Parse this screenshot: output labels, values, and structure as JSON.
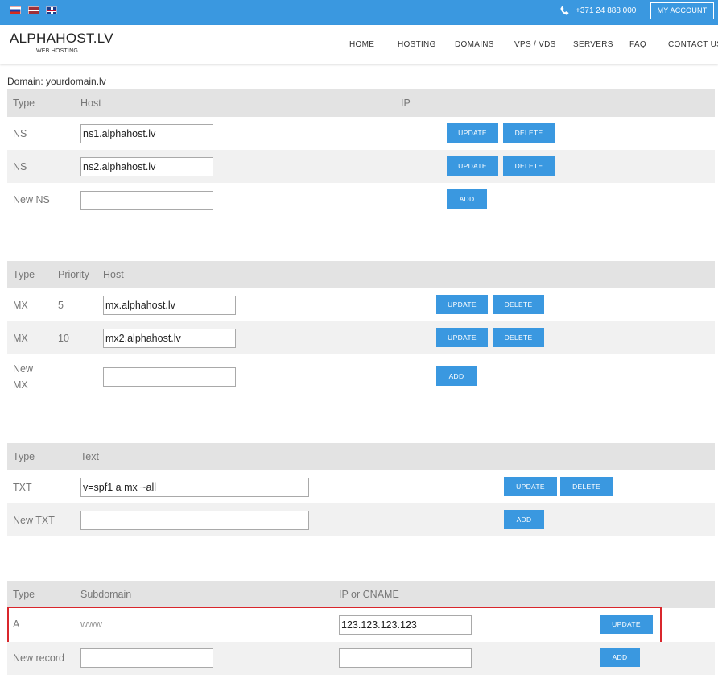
{
  "topbar": {
    "phone": "+371 24 888 000",
    "account_label": "MY ACCOUNT",
    "flags": [
      "flag-ru",
      "flag-lv",
      "flag-gb"
    ]
  },
  "header": {
    "logo": "ALPHAHOST.LV",
    "logo_sub": "WEB HOSTING",
    "nav": [
      "HOME",
      "HOSTING",
      "DOMAINS",
      "VPS / VDS",
      "SERVERS",
      "FAQ",
      "CONTACT US"
    ]
  },
  "domain_label": "Domain: yourdomain.lv",
  "buttons": {
    "update": "UPDATE",
    "delete": "DELETE",
    "add": "ADD"
  },
  "ns": {
    "headers": [
      "Type",
      "Host",
      "IP"
    ],
    "rows": [
      {
        "type": "NS",
        "host": "ns1.alphahost.lv"
      },
      {
        "type": "NS",
        "host": "ns2.alphahost.lv"
      }
    ],
    "new_label": "New NS"
  },
  "mx": {
    "headers": [
      "Type",
      "Priority",
      "Host"
    ],
    "rows": [
      {
        "type": "MX",
        "priority": "5",
        "host": "mx.alphahost.lv"
      },
      {
        "type": "MX",
        "priority": "10",
        "host": "mx2.alphahost.lv"
      }
    ],
    "new_label_1": "New",
    "new_label_2": "MX"
  },
  "txt": {
    "headers": [
      "Type",
      "Text"
    ],
    "rows": [
      {
        "type": "TXT",
        "text": "v=spf1 a mx ~all"
      }
    ],
    "new_label": "New TXT"
  },
  "a": {
    "headers": [
      "Type",
      "Subdomain",
      "IP or CNAME"
    ],
    "rows": [
      {
        "type": "A",
        "subdomain": "www",
        "ip": "123.123.123.123"
      }
    ],
    "new_label": "New record"
  },
  "colors": {
    "accent": "#3a98e0",
    "highlight": "#d9262c"
  },
  "icons": {
    "phone": "phone-icon"
  }
}
